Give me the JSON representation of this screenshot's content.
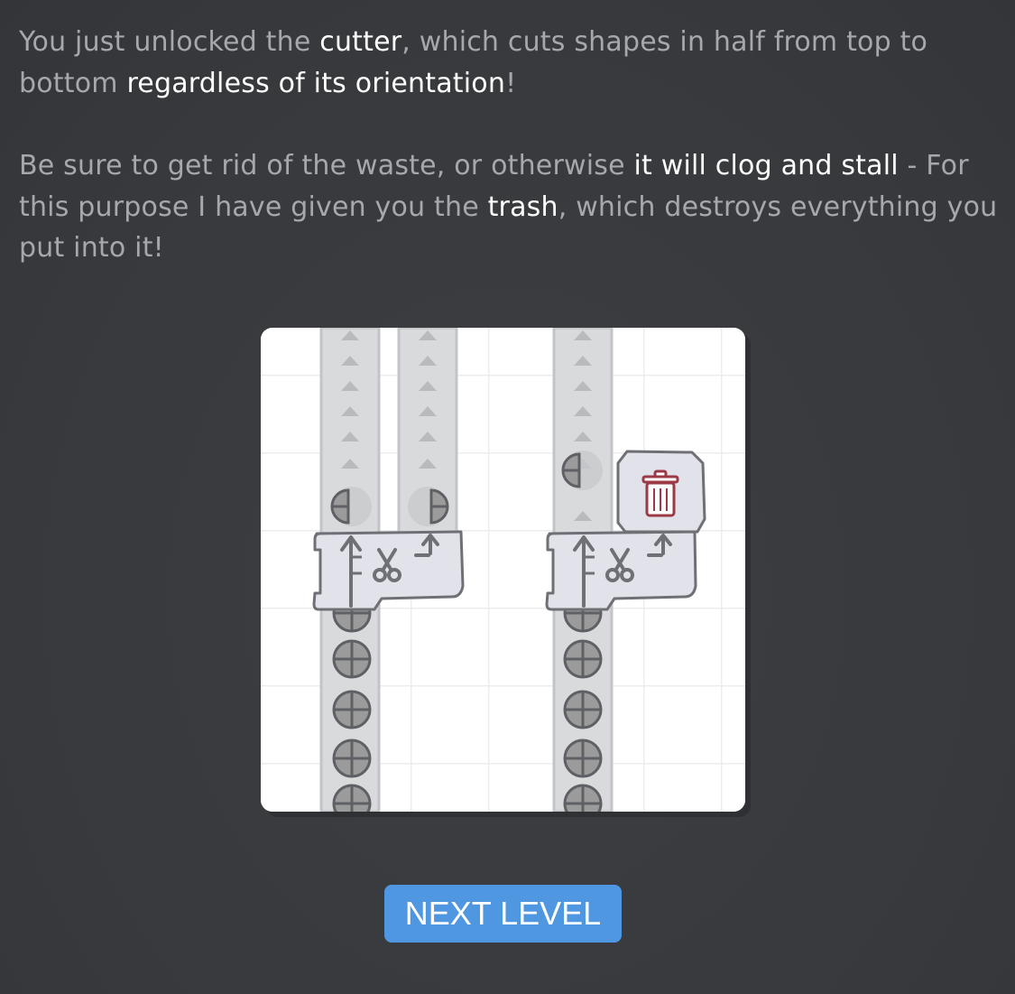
{
  "message": {
    "paragraph1": {
      "t1": "You just unlocked the ",
      "h1": "cutter",
      "t2": ", which cuts shapes in half from top to bottom ",
      "h2": "regardless of its orientation",
      "t3": "!"
    },
    "paragraph2": {
      "t1": "Be sure to get rid of the waste, or otherwise ",
      "h1": "it will clog and stall",
      "t2": " - For this purpose I have given you the ",
      "h2": "trash",
      "t3": ", which destroys everything you put into it!"
    }
  },
  "preview": {
    "icons": [
      "conveyor-belt-icon",
      "cutter-icon",
      "scissors-icon",
      "trash-icon",
      "circle-shape-icon",
      "half-circle-shape-icon"
    ],
    "colors": {
      "background": "#ffffff",
      "grid": "#ececec",
      "belt": "#d9dadc",
      "building": "#e2e3ea",
      "outline": "#6f7076",
      "shape_fill": "#9b9b9b",
      "trash_accent": "#9b3a46"
    }
  },
  "button": {
    "next_label": "NEXT LEVEL",
    "color": "#4f97e0"
  }
}
